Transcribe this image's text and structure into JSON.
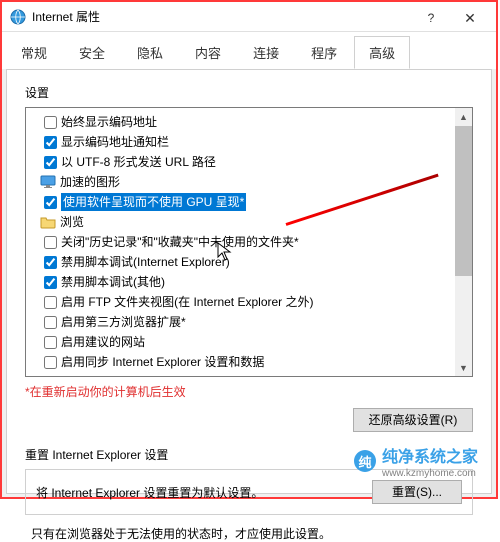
{
  "window": {
    "title": "Internet 属性"
  },
  "tabs": [
    "常规",
    "安全",
    "隐私",
    "内容",
    "连接",
    "程序",
    "高级"
  ],
  "active_tab_index": 6,
  "sections": {
    "settings_label": "设置",
    "reset_label": "重置 Internet Explorer 设置",
    "reset_desc": "将 Internet Explorer 设置重置为默认设置。",
    "bottom_desc": "只有在浏览器处于无法使用的状态时，才应使用此设置。"
  },
  "note": "*在重新启动你的计算机后生效",
  "buttons": {
    "restore": "还原高级设置(R)",
    "reset": "重置(S)..."
  },
  "groups": {
    "accel_graphics": "加速的图形",
    "browsing": "浏览"
  },
  "items": [
    {
      "checked": false,
      "label": "始终显示编码地址"
    },
    {
      "checked": true,
      "label": "显示编码地址通知栏"
    },
    {
      "checked": true,
      "label": "以 UTF-8 形式发送 URL 路径"
    }
  ],
  "items_accel": [
    {
      "checked": true,
      "label": "使用软件呈现而不使用 GPU 呈现*",
      "highlighted": true
    }
  ],
  "items_browsing": [
    {
      "checked": false,
      "label": "关闭\"历史记录\"和\"收藏夹\"中未使用的文件夹*"
    },
    {
      "checked": true,
      "label": "禁用脚本调试(Internet Explorer)"
    },
    {
      "checked": true,
      "label": "禁用脚本调试(其他)"
    },
    {
      "checked": false,
      "label": "启用 FTP 文件夹视图(在 Internet Explorer 之外)"
    },
    {
      "checked": false,
      "label": "启用第三方浏览器扩展*"
    },
    {
      "checked": false,
      "label": "启用建议的网站"
    },
    {
      "checked": false,
      "label": "启用同步 Internet Explorer 设置和数据"
    }
  ],
  "watermark": {
    "brand": "纯净系统之家",
    "url": "www.kzmyhome.com"
  }
}
